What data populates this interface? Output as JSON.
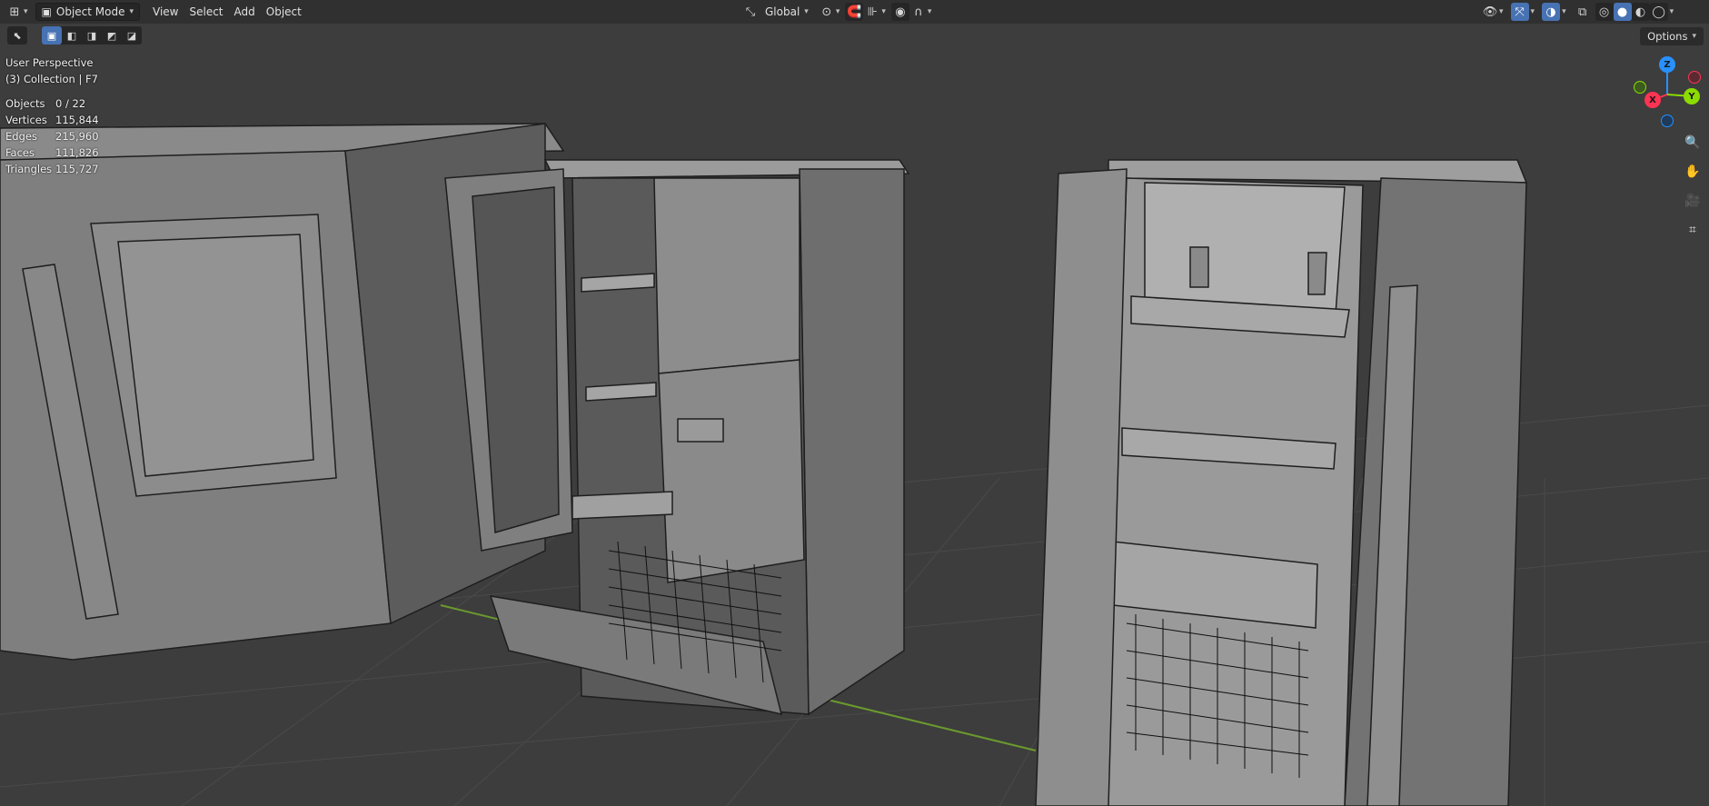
{
  "header": {
    "mode": "Object Mode",
    "menus": [
      "View",
      "Select",
      "Add",
      "Object"
    ],
    "transform_orientation": "Global"
  },
  "overlay": {
    "view_name": "User Perspective",
    "collection": "(3) Collection | F7"
  },
  "stats": [
    {
      "label": "Objects",
      "value": "0 / 22"
    },
    {
      "label": "Vertices",
      "value": "115,844"
    },
    {
      "label": "Edges",
      "value": "215,960"
    },
    {
      "label": "Faces",
      "value": "111,826"
    },
    {
      "label": "Triangles",
      "value": "115,727"
    }
  ],
  "options_label": "Options",
  "gizmo": {
    "z": "Z",
    "y": "Y",
    "x": "X"
  },
  "icons": {
    "editor_type": "editor-type-icon",
    "mode": "object-mode-icon",
    "orientation": "orientation-icon",
    "pivot": "pivot-icon",
    "snap": "snap-icon",
    "proportional": "proportional-edit-icon",
    "visibility": "eye-icon",
    "gizmos": "gizmo-icon",
    "overlays": "overlays-icon",
    "xray": "xray-icon",
    "shading": [
      "wireframe-icon",
      "solid-icon",
      "material-icon",
      "rendered-icon"
    ],
    "nav": [
      "zoom-icon",
      "hand-pan-icon",
      "camera-icon",
      "grid-view-icon"
    ]
  },
  "colors": {
    "header_bg": "#303030",
    "viewport_bg": "#3d3d3d",
    "accent": "#4772b3",
    "axis_x": "#ff3352",
    "axis_y": "#8bdc00",
    "axis_z": "#2890ff"
  }
}
